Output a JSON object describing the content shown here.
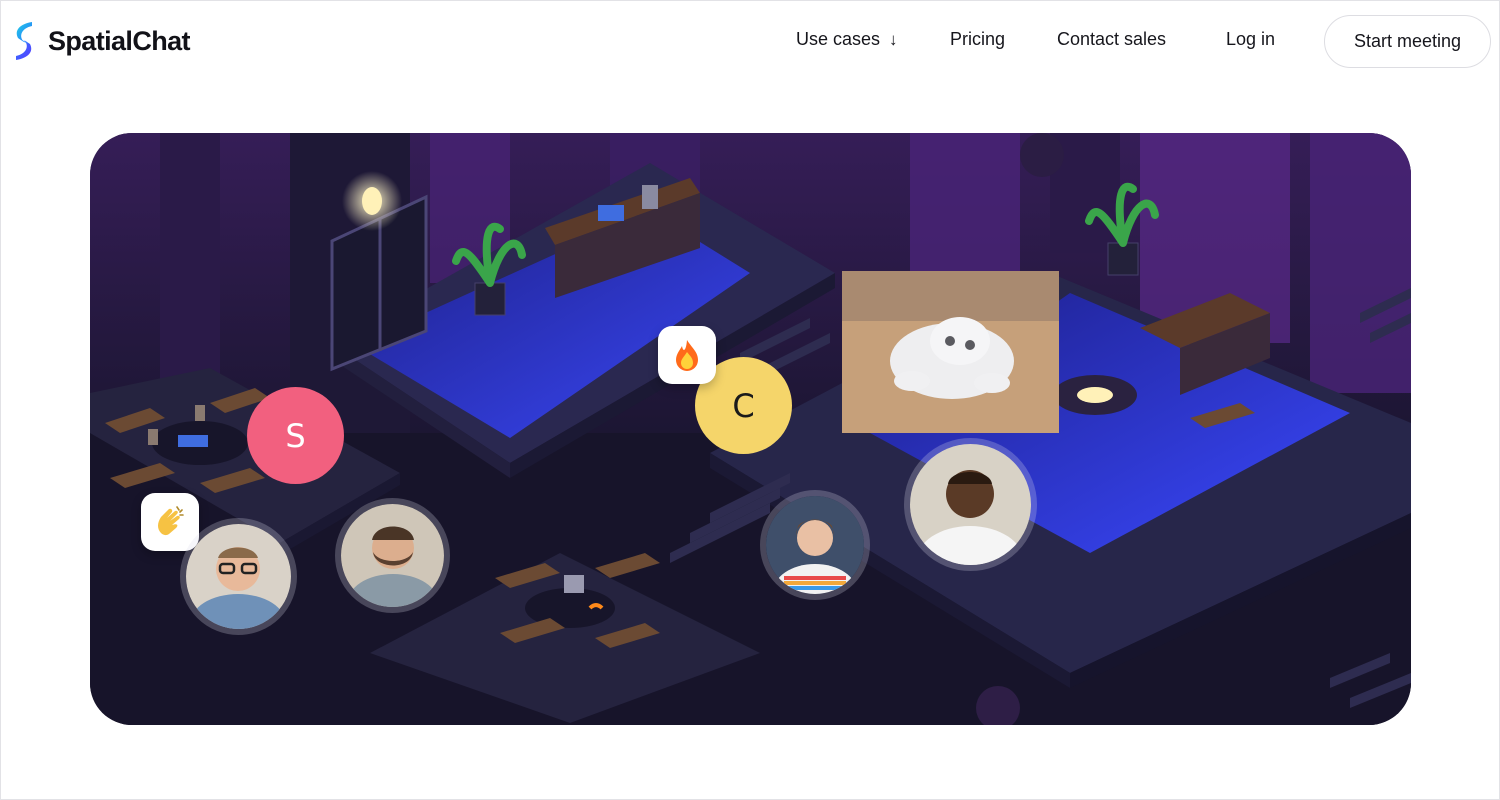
{
  "brand": {
    "name": "SpatialChat",
    "colors": {
      "accent_blue": "#2b7bff",
      "accent_cyan": "#1fd0e6",
      "text": "#14141a"
    }
  },
  "nav": {
    "use_cases": "Use cases",
    "use_cases_icon": "arrow-down-icon",
    "pricing": "Pricing",
    "contact_sales": "Contact sales",
    "log_in": "Log in",
    "start_meeting": "Start meeting"
  },
  "scene": {
    "avatars": [
      {
        "letter": "S",
        "color": "#f2607f"
      },
      {
        "letter": "C",
        "color": "#f5d56a",
        "text_color": "#1a1a1a"
      }
    ],
    "reactions": [
      {
        "icon": "fire-emoji-icon"
      },
      {
        "icon": "clapping-hands-emoji-icon"
      }
    ],
    "video_tile_icon": "cat-video-icon"
  }
}
